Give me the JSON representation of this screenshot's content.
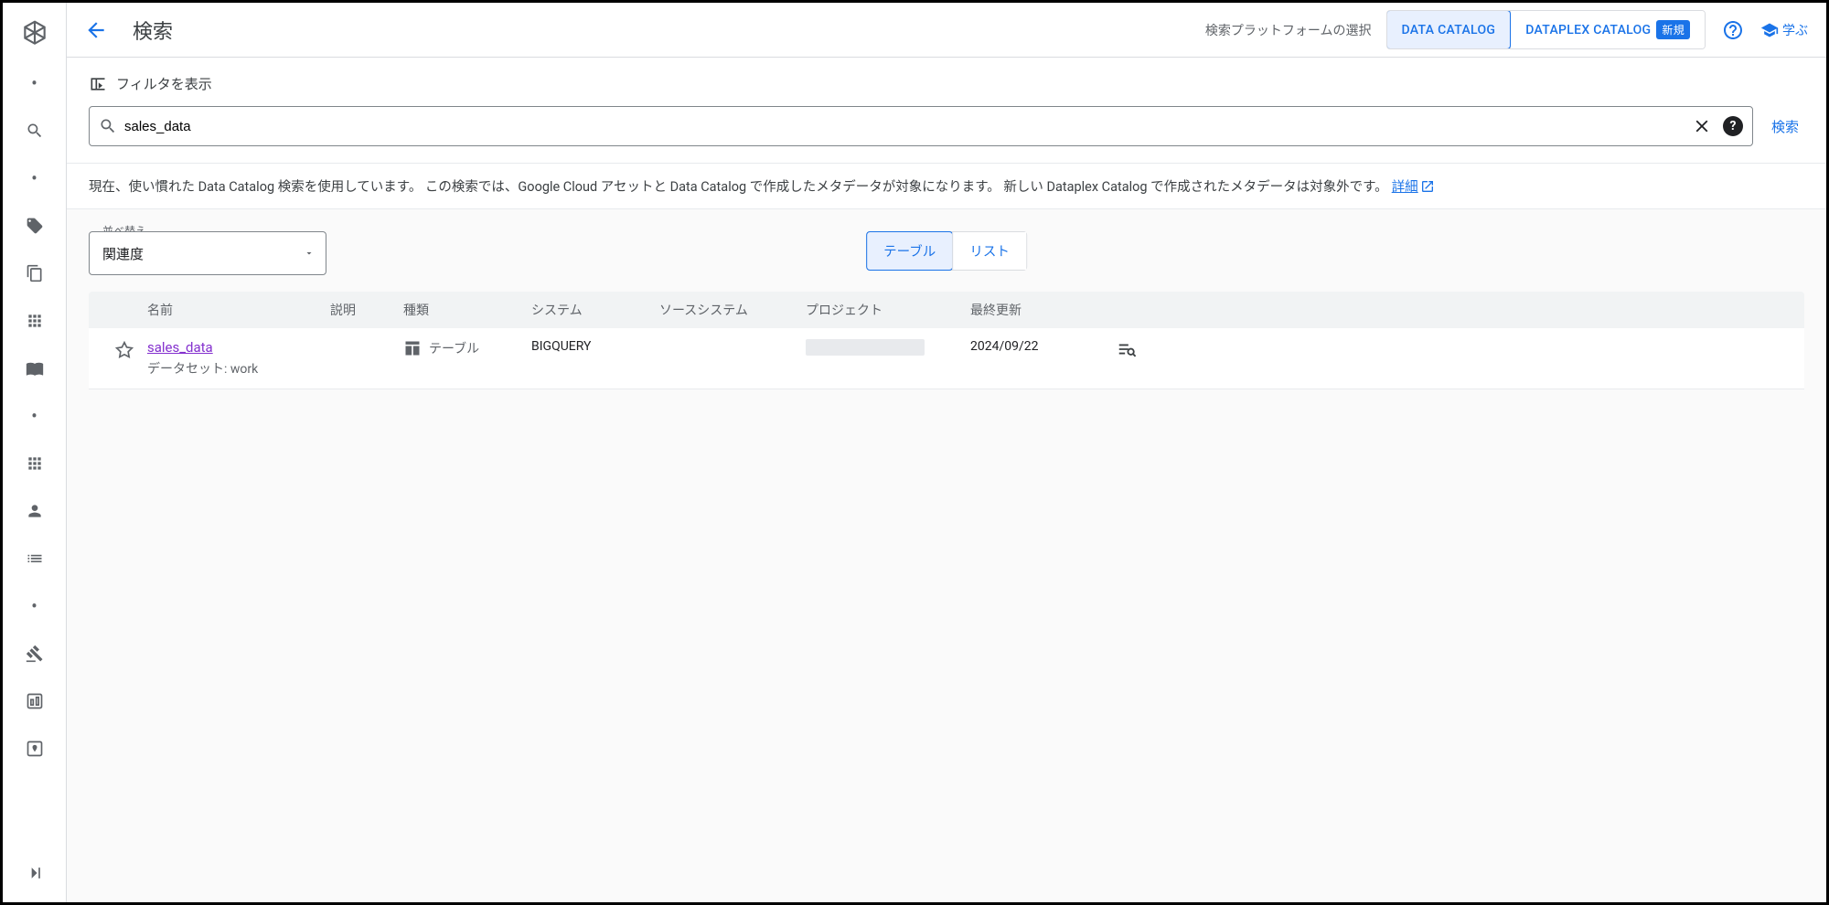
{
  "page": {
    "title": "検索"
  },
  "topbar": {
    "platform_select_label": "検索プラットフォームの選択",
    "tab_data_catalog": "DATA CATALOG",
    "tab_dataplex_catalog": "DATAPLEX CATALOG",
    "badge_new": "新規",
    "learn_label": "学ぶ"
  },
  "filter": {
    "show_filter_label": "フィルタを表示"
  },
  "search": {
    "value": "sales_data",
    "submit_label": "検索"
  },
  "notice": {
    "text": "現在、使い慣れた Data Catalog 検索を使用しています。 この検索では、Google Cloud アセットと Data Catalog で作成したメタデータが対象になります。 新しい Dataplex Catalog で作成されたメタデータは対象外です。",
    "link_label": "詳細"
  },
  "sort": {
    "label": "並べ替え",
    "value": "関連度"
  },
  "view": {
    "table_label": "テーブル",
    "list_label": "リスト"
  },
  "columns": {
    "name": "名前",
    "description": "説明",
    "type": "種類",
    "system": "システム",
    "source_system": "ソースシステム",
    "project": "プロジェクト",
    "last_updated": "最終更新"
  },
  "rows": [
    {
      "name": "sales_data",
      "subtitle_prefix": "データセット: ",
      "subtitle_value": "work",
      "type_label": "テーブル",
      "system": "BIGQUERY",
      "last_updated": "2024/09/22"
    }
  ]
}
